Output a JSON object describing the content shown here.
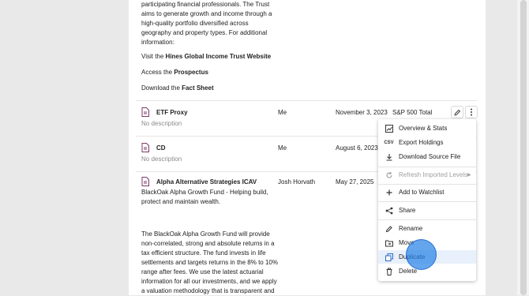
{
  "description_lines": [
    "participating financial professionals. The Trust",
    "aims to generate growth and income through a",
    "high-quality portfolio diversified across",
    "geography and property types. For additional",
    "information:"
  ],
  "links": {
    "visit_prefix": "Visit the ",
    "visit_bold": "Hines Global Income Trust Website",
    "access_prefix": "Access the ",
    "access_bold": "Prospectus",
    "download_prefix": "Download the ",
    "download_bold": "Fact Sheet"
  },
  "rows": [
    {
      "title": "ETF Proxy",
      "subtitle": "No description",
      "owner": "Me",
      "date": "November 3, 2023",
      "benchmark": "S&P 500 Total"
    },
    {
      "title": "CD",
      "subtitle": "No description",
      "owner": "Me",
      "date": "August 6, 2023"
    },
    {
      "title": "Alpha Alternative Strategies ICAV",
      "subtitle": "BlackOak Alpha Growth Fund - Helping build,",
      "subtitle2": "protect and maintain wealth.",
      "owner": "Josh Horvath",
      "date": "May 27, 2025"
    }
  ],
  "alpha_desc_lines": [
    "The BlackOak Alpha Growth Fund will provide",
    "non-correlated, strong and absolute returns in a",
    "tax efficient structure. The fund invests in life",
    "settlements and targets returns in the 8% to 10%",
    "range after fees. We use the latest actuarial",
    "information for all our investments, and we apply",
    "a valuation methodology that is transparent and"
  ],
  "menu": {
    "items": [
      {
        "label": "Overview & Stats",
        "icon": "chart-box-icon"
      },
      {
        "label": "Export Holdings",
        "icon": "csv-icon",
        "icon_text": "CSV"
      },
      {
        "label": "Download Source File",
        "icon": "download-icon"
      },
      {
        "label": "Refresh Imported Levels",
        "icon": "refresh-icon",
        "disabled": true
      },
      {
        "label": "Add to Watchlist",
        "icon": "plus-icon"
      },
      {
        "label": "Share",
        "icon": "share-icon"
      },
      {
        "label": "Rename",
        "icon": "pencil-icon"
      },
      {
        "label": "Move",
        "icon": "folder-move-icon"
      },
      {
        "label": "Duplicate",
        "icon": "duplicate-icon"
      },
      {
        "label": "Delete",
        "icon": "trash-icon"
      }
    ]
  },
  "colors": {
    "highlight": "#e8f0fb",
    "cursor": "#2882e6"
  }
}
